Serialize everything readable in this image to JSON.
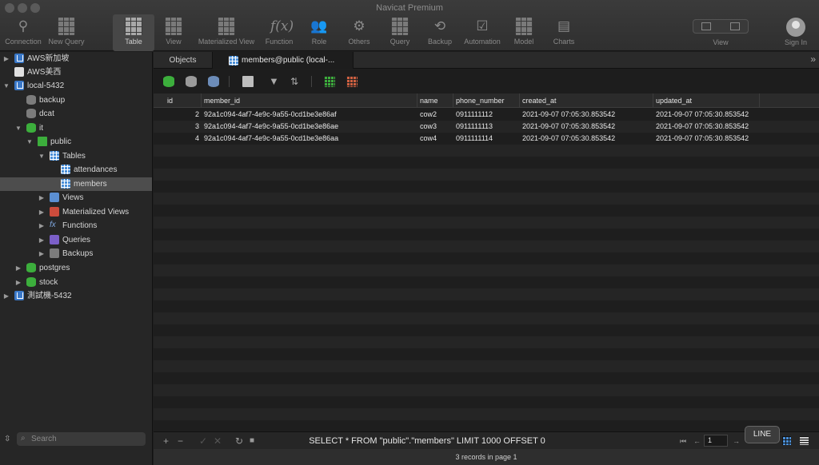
{
  "window": {
    "title": "Navicat Premium"
  },
  "toolbar": {
    "items": [
      {
        "label": "Connection",
        "icon": "plug-icon"
      },
      {
        "label": "New Query",
        "icon": "new-query-icon"
      },
      {
        "label": "Table",
        "icon": "table-icon"
      },
      {
        "label": "View",
        "icon": "view-icon"
      },
      {
        "label": "Materialized View",
        "icon": "materialized-view-icon"
      },
      {
        "label": "Function",
        "icon": "function-icon"
      },
      {
        "label": "Role",
        "icon": "role-icon"
      },
      {
        "label": "Others",
        "icon": "others-icon"
      },
      {
        "label": "Query",
        "icon": "query-icon"
      },
      {
        "label": "Backup",
        "icon": "backup-icon"
      },
      {
        "label": "Automation",
        "icon": "automation-icon"
      },
      {
        "label": "Model",
        "icon": "model-icon"
      },
      {
        "label": "Charts",
        "icon": "charts-icon"
      }
    ],
    "view_label": "View",
    "signin_label": "Sign In"
  },
  "sidebar": {
    "tree": [
      {
        "label": "AWS新加坡",
        "icon": "connection-icon"
      },
      {
        "label": "AWS美西",
        "icon": "connection-icon"
      },
      {
        "label": "local-5432",
        "icon": "connection-icon"
      },
      {
        "label": "backup",
        "icon": "database-icon"
      },
      {
        "label": "dcat",
        "icon": "database-icon"
      },
      {
        "label": "it",
        "icon": "database-icon"
      },
      {
        "label": "public",
        "icon": "schema-icon"
      },
      {
        "label": "Tables",
        "icon": "tables-icon"
      },
      {
        "label": "attendances",
        "icon": "table-icon"
      },
      {
        "label": "members",
        "icon": "table-icon"
      },
      {
        "label": "Views",
        "icon": "views-icon"
      },
      {
        "label": "Materialized Views",
        "icon": "materialized-views-icon"
      },
      {
        "label": "Functions",
        "icon": "function-icon"
      },
      {
        "label": "Queries",
        "icon": "queries-icon"
      },
      {
        "label": "Backups",
        "icon": "backups-icon"
      },
      {
        "label": "postgres",
        "icon": "database-icon"
      },
      {
        "label": "stock",
        "icon": "database-icon"
      },
      {
        "label": "測試機-5432",
        "icon": "connection-icon"
      }
    ],
    "search_placeholder": "Search"
  },
  "tabs": {
    "objects": "Objects",
    "members": "members@public (local-..."
  },
  "grid": {
    "columns": [
      "id",
      "member_id",
      "name",
      "phone_number",
      "created_at",
      "updated_at"
    ],
    "rows": [
      [
        "2",
        "92a1c094-4af7-4e9c-9a55-0cd1be3e86af",
        "cow2",
        "0911111112",
        "2021-09-07 07:05:30.853542",
        "2021-09-07 07:05:30.853542"
      ],
      [
        "3",
        "92a1c094-4af7-4e9c-9a55-0cd1be3e86ae",
        "cow3",
        "0911111113",
        "2021-09-07 07:05:30.853542",
        "2021-09-07 07:05:30.853542"
      ],
      [
        "4",
        "92a1c094-4af7-4e9c-9a55-0cd1be3e86aa",
        "cow4",
        "0911111114",
        "2021-09-07 07:05:30.853542",
        "2021-09-07 07:05:30.853542"
      ]
    ]
  },
  "footer": {
    "sql": "SELECT * FROM \"public\".\"members\" LIMIT 1000 OFFSET 0",
    "page": "1",
    "tooltip": "LINE",
    "status": "3 records in page 1"
  }
}
